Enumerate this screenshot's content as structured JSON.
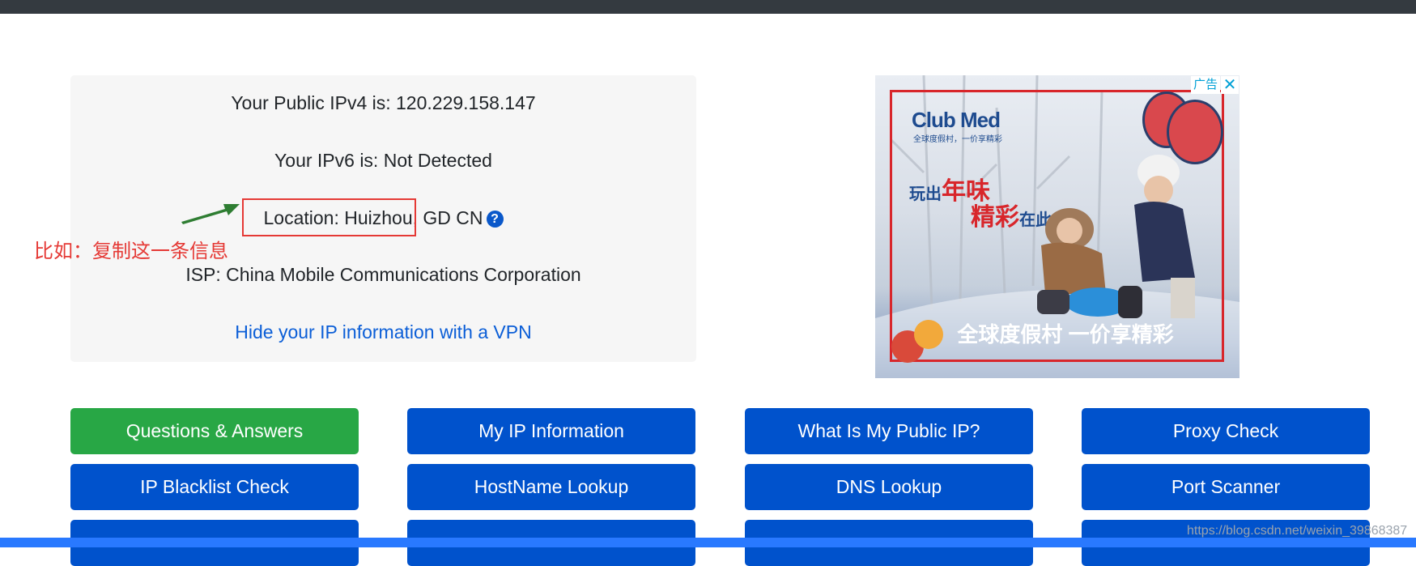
{
  "info": {
    "ipv4_line": "Your Public IPv4 is: 120.229.158.147",
    "ipv6_line": "Your IPv6 is: Not Detected",
    "location_line": "Location: Huizhou, GD CN",
    "help_icon": "question-circle-icon",
    "isp_line": "ISP: China Mobile Communications Corporation",
    "vpn_link": "Hide your IP information with a VPN"
  },
  "annotation": {
    "text": "比如：复制这一条信息",
    "color": "#e53935",
    "arrow_color": "#2e7d32"
  },
  "ad": {
    "badge": "广告",
    "close": "✕",
    "brand": "Club Med",
    "brand_sub": "全球度假村，一价享精彩",
    "slogan_prefix": "玩出",
    "slogan_red1": "年味",
    "slogan_red2": "精彩",
    "slogan_suffix": "在此",
    "bottom_text": "全球度假村 一价享精彩"
  },
  "buttons": {
    "row1": [
      "Questions & Answers",
      "My IP Information",
      "What Is My Public IP?",
      "Proxy Check"
    ],
    "row2": [
      "IP Blacklist Check",
      "HostName Lookup",
      "DNS Lookup",
      "Port Scanner"
    ],
    "row3": [
      "",
      "",
      "",
      ""
    ]
  },
  "colors": {
    "primary": "#0052cc",
    "success": "#28a745",
    "link": "#0b5ed7",
    "topbar": "#343a40"
  },
  "watermark": "https://blog.csdn.net/weixin_39868387"
}
